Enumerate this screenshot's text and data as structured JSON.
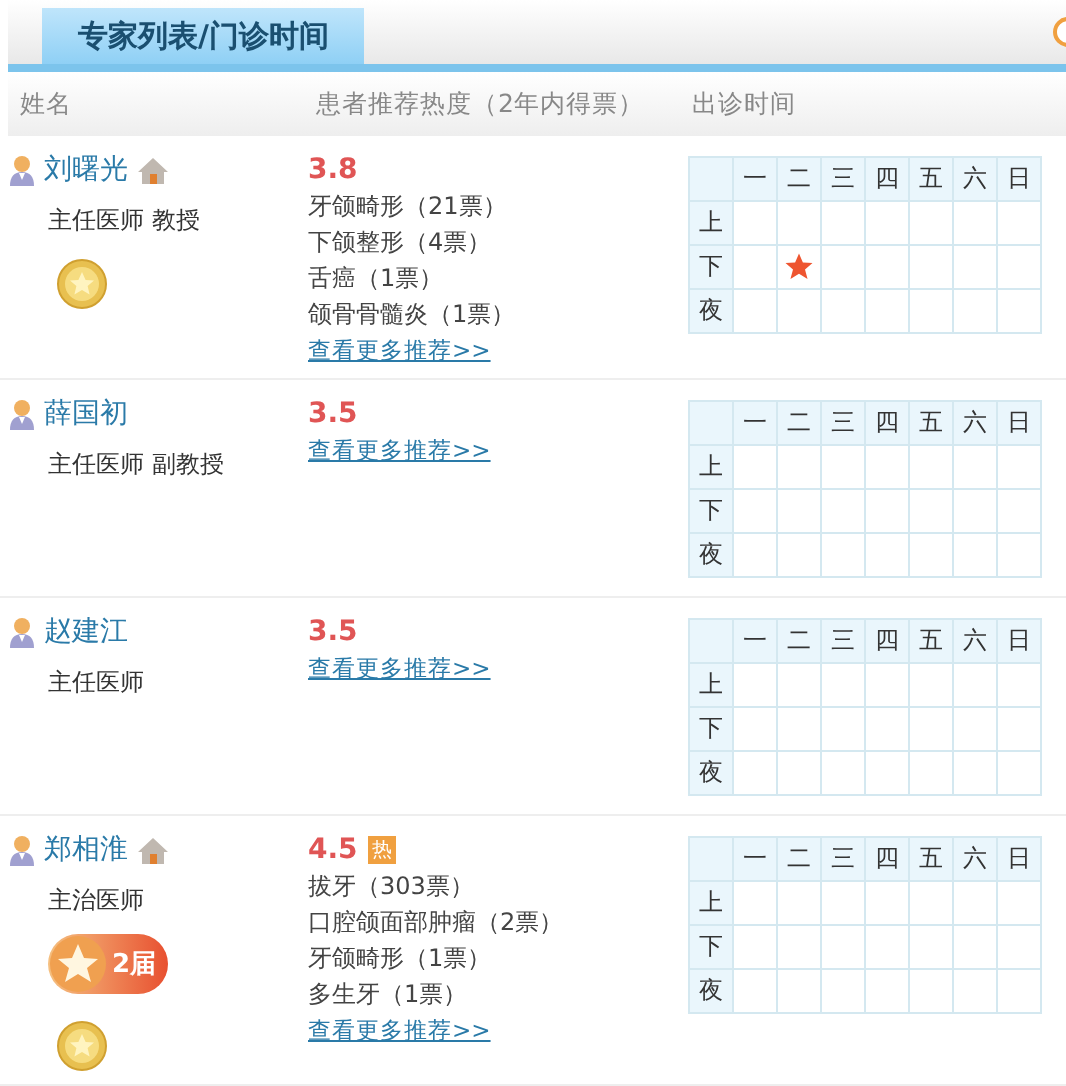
{
  "tab": {
    "title": "专家列表/门诊时间"
  },
  "columns": [
    "姓名",
    "患者推荐热度（2年内得票）",
    "出诊时间"
  ],
  "doctors": [
    {
      "name": "刘曙光",
      "homepage": true,
      "title": "主任医师  教授",
      "medal": true,
      "rating": "3.8",
      "recommendations": [
        "牙颌畸形（21票）",
        "下颌整形（4票）",
        "舌癌（1票）",
        "颌骨骨髓炎（1票）"
      ],
      "more_link": "查看更多推荐>>",
      "schedule": {
        "days": [
          "一",
          "二",
          "三",
          "四",
          "五",
          "六",
          "日"
        ],
        "periods": [
          {
            "label": "上",
            "slots": [
              false,
              false,
              false,
              false,
              false,
              false,
              false
            ]
          },
          {
            "label": "下",
            "slots": [
              false,
              true,
              false,
              false,
              false,
              false,
              false
            ]
          },
          {
            "label": "夜",
            "slots": [
              false,
              false,
              false,
              false,
              false,
              false,
              false
            ]
          }
        ]
      }
    },
    {
      "name": "薛国初",
      "homepage": false,
      "title": "主任医师  副教授",
      "medal": false,
      "rating": "3.5",
      "more_link": "查看更多推荐>>",
      "schedule": {
        "days": [
          "一",
          "二",
          "三",
          "四",
          "五",
          "六",
          "日"
        ],
        "periods": [
          {
            "label": "上",
            "slots": [
              false,
              false,
              false,
              false,
              false,
              false,
              false
            ]
          },
          {
            "label": "下",
            "slots": [
              false,
              false,
              false,
              false,
              false,
              false,
              false
            ]
          },
          {
            "label": "夜",
            "slots": [
              false,
              false,
              false,
              false,
              false,
              false,
              false
            ]
          }
        ]
      }
    },
    {
      "name": "赵建江",
      "homepage": false,
      "title": "主任医师",
      "medal": false,
      "rating": "3.5",
      "more_link": "查看更多推荐>>",
      "schedule": {
        "days": [
          "一",
          "二",
          "三",
          "四",
          "五",
          "六",
          "日"
        ],
        "periods": [
          {
            "label": "上",
            "slots": [
              false,
              false,
              false,
              false,
              false,
              false,
              false
            ]
          },
          {
            "label": "下",
            "slots": [
              false,
              false,
              false,
              false,
              false,
              false,
              false
            ]
          },
          {
            "label": "夜",
            "slots": [
              false,
              false,
              false,
              false,
              false,
              false,
              false
            ]
          }
        ]
      }
    },
    {
      "name": "郑相淮",
      "homepage": true,
      "title": "主治医师",
      "award": "2届",
      "medal": true,
      "rating": "4.5",
      "hot": "热",
      "recommendations": [
        "拔牙（303票）",
        "口腔颌面部肿瘤（2票）",
        "牙颌畸形（1票）",
        "多生牙（1票）"
      ],
      "more_link": "查看更多推荐>>",
      "schedule": {
        "days": [
          "一",
          "二",
          "三",
          "四",
          "五",
          "六",
          "日"
        ],
        "periods": [
          {
            "label": "上",
            "slots": [
              false,
              false,
              false,
              false,
              false,
              false,
              false
            ]
          },
          {
            "label": "下",
            "slots": [
              false,
              false,
              false,
              false,
              false,
              false,
              false
            ]
          },
          {
            "label": "夜",
            "slots": [
              false,
              false,
              false,
              false,
              false,
              false,
              false
            ]
          }
        ]
      }
    }
  ]
}
